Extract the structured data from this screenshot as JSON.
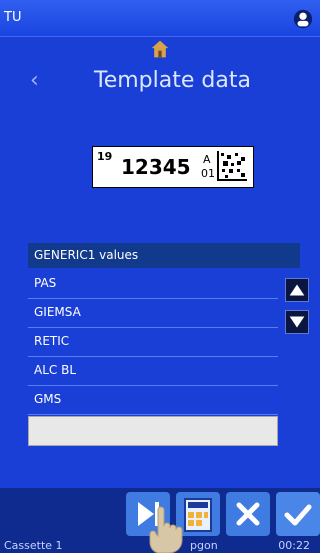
{
  "status": {
    "top_left": "TU",
    "bottom_left": "Cassette 1",
    "bottom_middle": "pgon",
    "time": "00:22"
  },
  "header": {
    "title": "Template data"
  },
  "label_preview": {
    "small_number": "19",
    "main_number": "12345",
    "side_top": "A",
    "side_bottom": "01"
  },
  "list": {
    "title": "GENERIC1 values",
    "items": [
      "PAS",
      "GIEMSA",
      "RETIC",
      "ALC BL",
      "GMS"
    ],
    "input_value": ""
  },
  "icons": {
    "home": "home-icon",
    "back": "chevron-left-icon",
    "scroll_up": "triangle-up-icon",
    "scroll_down": "triangle-down-icon",
    "skip": "skip-next-icon",
    "edit": "edit-template-icon",
    "cancel": "close-icon",
    "confirm": "check-icon",
    "corner": "user-icon"
  },
  "colors": {
    "background": "#1a3fd6",
    "header_bar": "#123a8c",
    "footer": "#0f2b8f",
    "confirm": "#4a86e8",
    "cancel": "#4a86e8"
  }
}
